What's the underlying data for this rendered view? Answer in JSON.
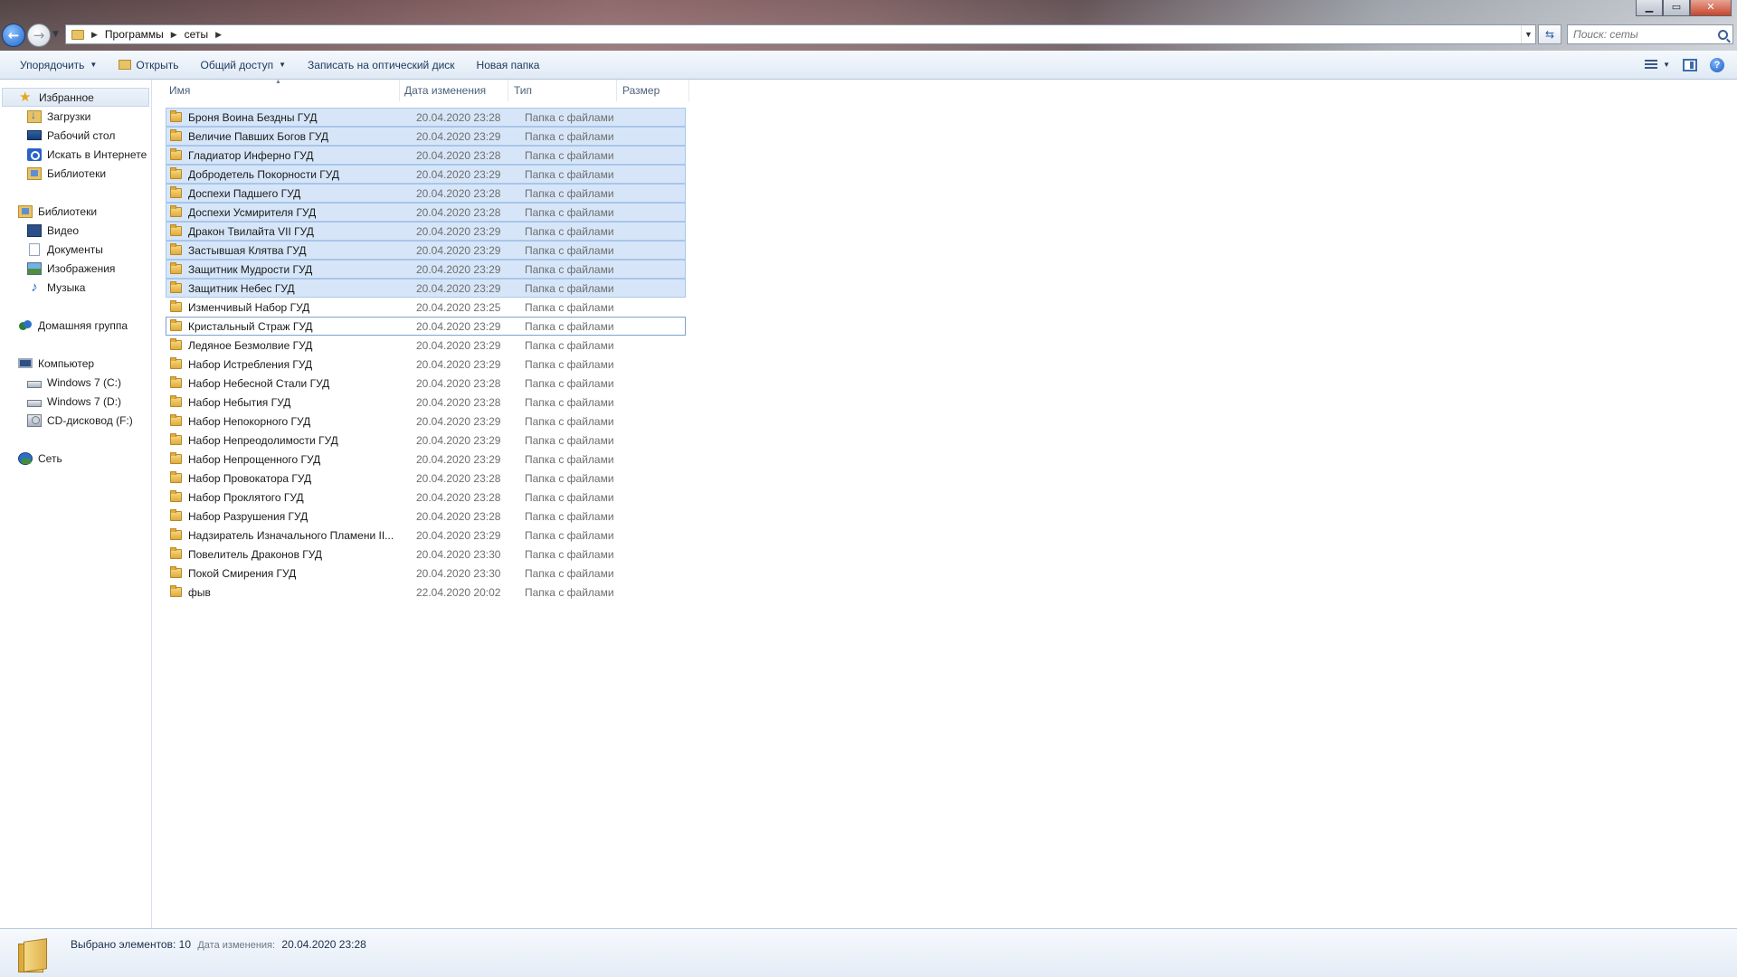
{
  "window": {
    "controls": {
      "minimize": "▁",
      "maximize": "▭",
      "close": "✕"
    }
  },
  "address": {
    "crumbs": [
      "Программы",
      "сеты"
    ]
  },
  "search": {
    "placeholder": "Поиск: сеты"
  },
  "commands": {
    "organize": "Упорядочить",
    "open": "Открыть",
    "share": "Общий доступ",
    "burn": "Записать на оптический диск",
    "new_folder": "Новая папка"
  },
  "nav": {
    "favorites": "Избранное",
    "downloads": "Загрузки",
    "desktop": "Рабочий стол",
    "web_search": "Искать в Интернете",
    "libraries_link": "Библиотеки",
    "libraries": "Библиотеки",
    "video": "Видео",
    "documents": "Документы",
    "images": "Изображения",
    "music": "Музыка",
    "homegroup": "Домашняя группа",
    "computer": "Компьютер",
    "drive_c": "Windows 7 (C:)",
    "drive_d": "Windows 7 (D:)",
    "drive_f": "CD-дисковод (F:)",
    "network": "Сеть"
  },
  "columns": {
    "name": "Имя",
    "date": "Дата изменения",
    "type": "Тип",
    "size": "Размер"
  },
  "files": [
    {
      "name": "Броня Воина Бездны ГУД",
      "date": "20.04.2020 23:28",
      "type": "Папка с файлами",
      "selected": true
    },
    {
      "name": "Величие Павших Богов ГУД",
      "date": "20.04.2020 23:29",
      "type": "Папка с файлами",
      "selected": true
    },
    {
      "name": "Гладиатор Инферно ГУД",
      "date": "20.04.2020 23:28",
      "type": "Папка с файлами",
      "selected": true
    },
    {
      "name": "Добродетель Покорности ГУД",
      "date": "20.04.2020 23:29",
      "type": "Папка с файлами",
      "selected": true
    },
    {
      "name": "Доспехи Падшего ГУД",
      "date": "20.04.2020 23:28",
      "type": "Папка с файлами",
      "selected": true
    },
    {
      "name": "Доспехи Усмирителя ГУД",
      "date": "20.04.2020 23:28",
      "type": "Папка с файлами",
      "selected": true
    },
    {
      "name": "Дракон Твилайта VII ГУД",
      "date": "20.04.2020 23:29",
      "type": "Папка с файлами",
      "selected": true
    },
    {
      "name": "Застывшая Клятва ГУД",
      "date": "20.04.2020 23:29",
      "type": "Папка с файлами",
      "selected": true
    },
    {
      "name": "Защитник Мудрости ГУД",
      "date": "20.04.2020 23:29",
      "type": "Папка с файлами",
      "selected": true
    },
    {
      "name": "Защитник Небес ГУД",
      "date": "20.04.2020 23:29",
      "type": "Папка с файлами",
      "selected": true
    },
    {
      "name": "Изменчивый Набор ГУД",
      "date": "20.04.2020 23:25",
      "type": "Папка с файлами",
      "selected": false
    },
    {
      "name": "Кристальный Страж ГУД",
      "date": "20.04.2020 23:29",
      "type": "Папка с файлами",
      "selected": false,
      "focused": true
    },
    {
      "name": "Ледяное Безмолвие ГУД",
      "date": "20.04.2020 23:29",
      "type": "Папка с файлами",
      "selected": false
    },
    {
      "name": "Набор Истребления ГУД",
      "date": "20.04.2020 23:29",
      "type": "Папка с файлами",
      "selected": false
    },
    {
      "name": "Набор Небесной Стали ГУД",
      "date": "20.04.2020 23:28",
      "type": "Папка с файлами",
      "selected": false
    },
    {
      "name": "Набор Небытия ГУД",
      "date": "20.04.2020 23:28",
      "type": "Папка с файлами",
      "selected": false
    },
    {
      "name": "Набор Непокорного ГУД",
      "date": "20.04.2020 23:29",
      "type": "Папка с файлами",
      "selected": false
    },
    {
      "name": "Набор Непреодолимости ГУД",
      "date": "20.04.2020 23:29",
      "type": "Папка с файлами",
      "selected": false
    },
    {
      "name": "Набор Непрощенного ГУД",
      "date": "20.04.2020 23:29",
      "type": "Папка с файлами",
      "selected": false
    },
    {
      "name": "Набор Провокатора ГУД",
      "date": "20.04.2020 23:28",
      "type": "Папка с файлами",
      "selected": false
    },
    {
      "name": "Набор Проклятого ГУД",
      "date": "20.04.2020 23:28",
      "type": "Папка с файлами",
      "selected": false
    },
    {
      "name": "Набор Разрушения ГУД",
      "date": "20.04.2020 23:28",
      "type": "Папка с файлами",
      "selected": false
    },
    {
      "name": "Надзиратель Изначального Пламени II...",
      "date": "20.04.2020 23:29",
      "type": "Папка с файлами",
      "selected": false
    },
    {
      "name": "Повелитель Драконов ГУД",
      "date": "20.04.2020 23:30",
      "type": "Папка с файлами",
      "selected": false
    },
    {
      "name": "Покой Смирения ГУД",
      "date": "20.04.2020 23:30",
      "type": "Папка с файлами",
      "selected": false
    },
    {
      "name": "фыв",
      "date": "22.04.2020 20:02",
      "type": "Папка с файлами",
      "selected": false
    }
  ],
  "details": {
    "count": "Выбрано элементов: 10",
    "date_label": "Дата изменения:",
    "date_value": "20.04.2020 23:28"
  }
}
